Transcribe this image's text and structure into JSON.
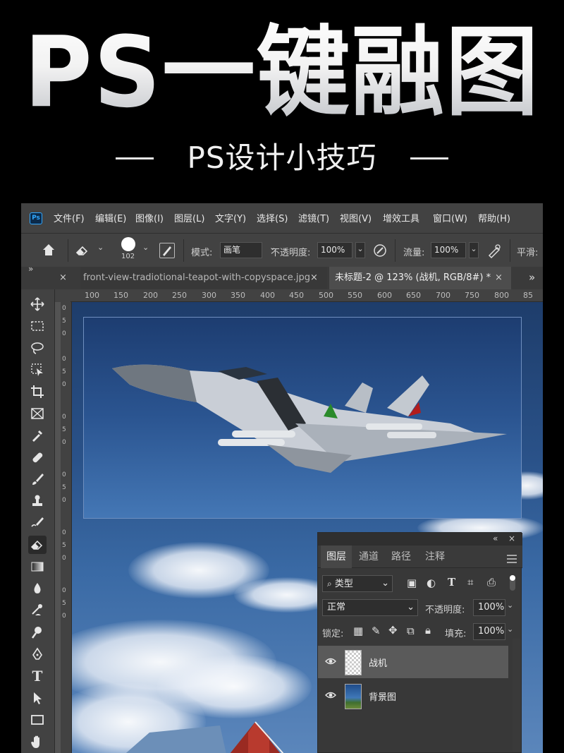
{
  "banner": {
    "title": "PS一键融图",
    "subtitle": "PS设计小技巧"
  },
  "menubar": {
    "logo": "Ps",
    "items": [
      "文件(F)",
      "编辑(E)",
      "图像(I)",
      "图层(L)",
      "文字(Y)",
      "选择(S)",
      "滤镜(T)",
      "视图(V)",
      "增效工具",
      "窗口(W)",
      "帮助(H)"
    ]
  },
  "options": {
    "brush_size": "102",
    "mode_label": "模式:",
    "mode_value": "画笔",
    "opacity_label": "不透明度:",
    "opacity_value": "100%",
    "flow_label": "流量:",
    "flow_value": "100%",
    "smooth_label": "平滑:"
  },
  "tabs": {
    "collapse": "»",
    "inactive_doc": "front-view-tradiotional-teapot-with-copyspace.jpg",
    "active_doc": "未标题-2 @ 123% (战机, RGB/8#) *",
    "overflow": "»"
  },
  "ruler": {
    "h_labels": [
      "100",
      "150",
      "200",
      "250",
      "300",
      "350",
      "400",
      "450",
      "500",
      "550",
      "600",
      "650",
      "700",
      "750",
      "800",
      "85"
    ],
    "v_labels": [
      "0",
      "5",
      "0",
      "0",
      "5",
      "0",
      "0",
      "5",
      "0",
      "0",
      "5",
      "0",
      "0",
      "5",
      "0",
      "0",
      "5",
      "0"
    ]
  },
  "layers_panel": {
    "tabs": [
      "图层",
      "通道",
      "路径",
      "注释"
    ],
    "filter_value": "类型",
    "blend_mode": "正常",
    "opacity_label": "不透明度:",
    "opacity_value": "100%",
    "lock_label": "锁定:",
    "fill_label": "填充:",
    "fill_value": "100%",
    "layers": [
      {
        "name": "战机",
        "selected": true
      },
      {
        "name": "背景图",
        "selected": false
      }
    ]
  },
  "icons": [
    "move-icon",
    "marquee-icon",
    "lasso-icon",
    "object-select-icon",
    "crop-icon",
    "frame-icon",
    "eyedropper-icon",
    "healing-icon",
    "brush-icon",
    "stamp-icon",
    "history-brush-icon",
    "eraser-icon",
    "gradient-icon",
    "blur-icon",
    "dodge-icon",
    "burn-icon",
    "pen-icon",
    "type-icon",
    "path-select-icon",
    "rectangle-icon",
    "hand-icon",
    "zoom-icon"
  ]
}
